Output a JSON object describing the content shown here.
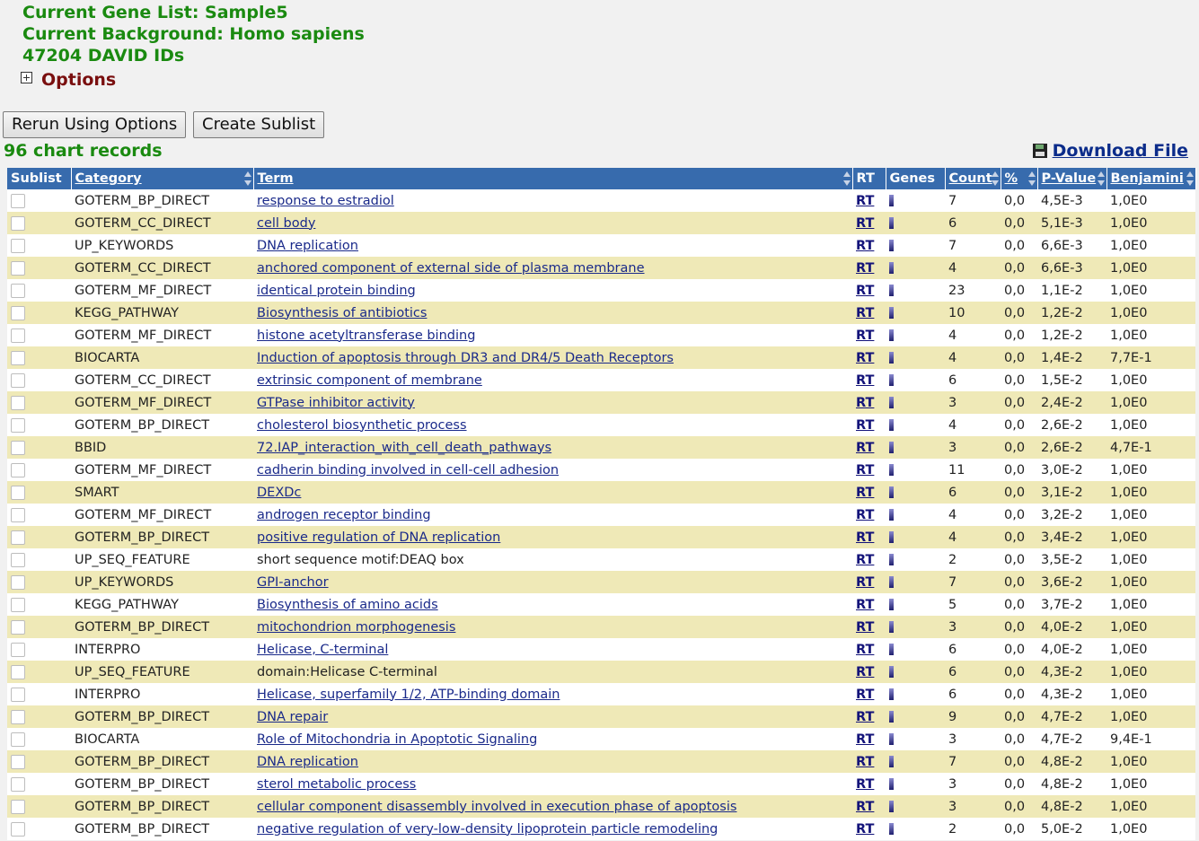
{
  "header": {
    "gene_list": "Current Gene List: Sample5",
    "background": "Current Background: Homo sapiens",
    "ids": "47204 DAVID IDs",
    "options_label": "Options"
  },
  "buttons": {
    "rerun": "Rerun Using Options",
    "sublist": "Create Sublist"
  },
  "records_label": "96 chart records",
  "download_label": "Download File",
  "columns": [
    "Sublist",
    "Category",
    "Term",
    "RT",
    "Genes",
    "Count",
    "%",
    "P-Value",
    "Benjamini"
  ],
  "rows": [
    {
      "category": "GOTERM_BP_DIRECT",
      "term": "response to estradiol",
      "link": true,
      "rt": "RT",
      "count": "7",
      "pct": "0,0",
      "pvalue": "4,5E-3",
      "benjamini": "1,0E0"
    },
    {
      "category": "GOTERM_CC_DIRECT",
      "term": "cell body",
      "link": true,
      "rt": "RT",
      "count": "6",
      "pct": "0,0",
      "pvalue": "5,1E-3",
      "benjamini": "1,0E0"
    },
    {
      "category": "UP_KEYWORDS",
      "term": "DNA replication",
      "link": true,
      "rt": "RT",
      "count": "7",
      "pct": "0,0",
      "pvalue": "6,6E-3",
      "benjamini": "1,0E0"
    },
    {
      "category": "GOTERM_CC_DIRECT",
      "term": "anchored component of external side of plasma membrane",
      "link": true,
      "rt": "RT",
      "count": "4",
      "pct": "0,0",
      "pvalue": "6,6E-3",
      "benjamini": "1,0E0"
    },
    {
      "category": "GOTERM_MF_DIRECT",
      "term": "identical protein binding",
      "link": true,
      "rt": "RT",
      "count": "23",
      "pct": "0,0",
      "pvalue": "1,1E-2",
      "benjamini": "1,0E0"
    },
    {
      "category": "KEGG_PATHWAY",
      "term": "Biosynthesis of antibiotics",
      "link": true,
      "rt": "RT",
      "count": "10",
      "pct": "0,0",
      "pvalue": "1,2E-2",
      "benjamini": "1,0E0"
    },
    {
      "category": "GOTERM_MF_DIRECT",
      "term": "histone acetyltransferase binding",
      "link": true,
      "rt": "RT",
      "count": "4",
      "pct": "0,0",
      "pvalue": "1,2E-2",
      "benjamini": "1,0E0"
    },
    {
      "category": "BIOCARTA",
      "term": "Induction of apoptosis through DR3 and DR4/5 Death Receptors",
      "link": true,
      "rt": "RT",
      "count": "4",
      "pct": "0,0",
      "pvalue": "1,4E-2",
      "benjamini": "7,7E-1"
    },
    {
      "category": "GOTERM_CC_DIRECT",
      "term": "extrinsic component of membrane",
      "link": true,
      "rt": "RT",
      "count": "6",
      "pct": "0,0",
      "pvalue": "1,5E-2",
      "benjamini": "1,0E0"
    },
    {
      "category": "GOTERM_MF_DIRECT",
      "term": "GTPase inhibitor activity",
      "link": true,
      "rt": "RT",
      "count": "3",
      "pct": "0,0",
      "pvalue": "2,4E-2",
      "benjamini": "1,0E0"
    },
    {
      "category": "GOTERM_BP_DIRECT",
      "term": "cholesterol biosynthetic process",
      "link": true,
      "rt": "RT",
      "count": "4",
      "pct": "0,0",
      "pvalue": "2,6E-2",
      "benjamini": "1,0E0"
    },
    {
      "category": "BBID",
      "term": "72.IAP_interaction_with_cell_death_pathways",
      "link": true,
      "rt": "RT",
      "count": "3",
      "pct": "0,0",
      "pvalue": "2,6E-2",
      "benjamini": "4,7E-1"
    },
    {
      "category": "GOTERM_MF_DIRECT",
      "term": "cadherin binding involved in cell-cell adhesion",
      "link": true,
      "rt": "RT",
      "count": "11",
      "pct": "0,0",
      "pvalue": "3,0E-2",
      "benjamini": "1,0E0"
    },
    {
      "category": "SMART",
      "term": "DEXDc",
      "link": true,
      "rt": "RT",
      "count": "6",
      "pct": "0,0",
      "pvalue": "3,1E-2",
      "benjamini": "1,0E0"
    },
    {
      "category": "GOTERM_MF_DIRECT",
      "term": "androgen receptor binding",
      "link": true,
      "rt": "RT",
      "count": "4",
      "pct": "0,0",
      "pvalue": "3,2E-2",
      "benjamini": "1,0E0"
    },
    {
      "category": "GOTERM_BP_DIRECT",
      "term": "positive regulation of DNA replication",
      "link": true,
      "rt": "RT",
      "count": "4",
      "pct": "0,0",
      "pvalue": "3,4E-2",
      "benjamini": "1,0E0"
    },
    {
      "category": "UP_SEQ_FEATURE",
      "term": "short sequence motif:DEAQ box",
      "link": false,
      "rt": "RT",
      "count": "2",
      "pct": "0,0",
      "pvalue": "3,5E-2",
      "benjamini": "1,0E0"
    },
    {
      "category": "UP_KEYWORDS",
      "term": "GPI-anchor",
      "link": true,
      "rt": "RT",
      "count": "7",
      "pct": "0,0",
      "pvalue": "3,6E-2",
      "benjamini": "1,0E0"
    },
    {
      "category": "KEGG_PATHWAY",
      "term": "Biosynthesis of amino acids",
      "link": true,
      "rt": "RT",
      "count": "5",
      "pct": "0,0",
      "pvalue": "3,7E-2",
      "benjamini": "1,0E0"
    },
    {
      "category": "GOTERM_BP_DIRECT",
      "term": "mitochondrion morphogenesis",
      "link": true,
      "rt": "RT",
      "count": "3",
      "pct": "0,0",
      "pvalue": "4,0E-2",
      "benjamini": "1,0E0"
    },
    {
      "category": "INTERPRO",
      "term": "Helicase, C-terminal",
      "link": true,
      "rt": "RT",
      "count": "6",
      "pct": "0,0",
      "pvalue": "4,0E-2",
      "benjamini": "1,0E0"
    },
    {
      "category": "UP_SEQ_FEATURE",
      "term": "domain:Helicase C-terminal",
      "link": false,
      "rt": "RT",
      "count": "6",
      "pct": "0,0",
      "pvalue": "4,3E-2",
      "benjamini": "1,0E0"
    },
    {
      "category": "INTERPRO",
      "term": "Helicase, superfamily 1/2, ATP-binding domain",
      "link": true,
      "rt": "RT",
      "count": "6",
      "pct": "0,0",
      "pvalue": "4,3E-2",
      "benjamini": "1,0E0"
    },
    {
      "category": "GOTERM_BP_DIRECT",
      "term": "DNA repair",
      "link": true,
      "rt": "RT",
      "count": "9",
      "pct": "0,0",
      "pvalue": "4,7E-2",
      "benjamini": "1,0E0"
    },
    {
      "category": "BIOCARTA",
      "term": "Role of Mitochondria in Apoptotic Signaling",
      "link": true,
      "rt": "RT",
      "count": "3",
      "pct": "0,0",
      "pvalue": "4,7E-2",
      "benjamini": "9,4E-1"
    },
    {
      "category": "GOTERM_BP_DIRECT",
      "term": "DNA replication",
      "link": true,
      "rt": "RT",
      "count": "7",
      "pct": "0,0",
      "pvalue": "4,8E-2",
      "benjamini": "1,0E0"
    },
    {
      "category": "GOTERM_BP_DIRECT",
      "term": "sterol metabolic process",
      "link": true,
      "rt": "RT",
      "count": "3",
      "pct": "0,0",
      "pvalue": "4,8E-2",
      "benjamini": "1,0E0"
    },
    {
      "category": "GOTERM_BP_DIRECT",
      "term": "cellular component disassembly involved in execution phase of apoptosis",
      "link": true,
      "rt": "RT",
      "count": "3",
      "pct": "0,0",
      "pvalue": "4,8E-2",
      "benjamini": "1,0E0"
    },
    {
      "category": "GOTERM_BP_DIRECT",
      "term": "negative regulation of very-low-density lipoprotein particle remodeling",
      "link": true,
      "rt": "RT",
      "count": "2",
      "pct": "0,0",
      "pvalue": "5,0E-2",
      "benjamini": "1,0E0"
    }
  ]
}
